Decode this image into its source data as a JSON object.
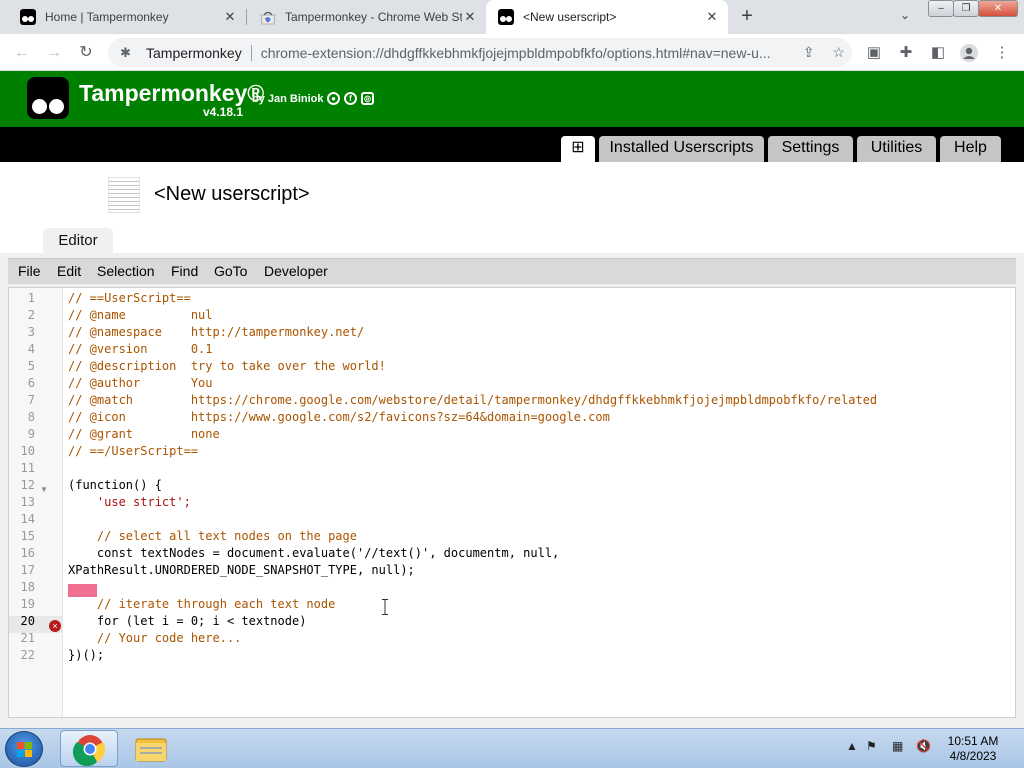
{
  "browser": {
    "tabs": [
      {
        "title": "Home | Tampermonkey",
        "icon": "tampermonkey-icon"
      },
      {
        "title": "Tampermonkey - Chrome Web Store",
        "icon": "chrome-web-store-icon"
      },
      {
        "title": "<New userscript>",
        "icon": "tampermonkey-icon"
      }
    ],
    "newtab_glyph": "+",
    "site_chip": "Tampermonkey",
    "url": "chrome-extension://dhdgffkkebhmkfjojejmpbldmpobfkfo/options.html#nav=new-u..."
  },
  "tm": {
    "brand": "Tampermonkey®",
    "by": "by Jan Biniok",
    "version": "v4.18.1",
    "nav": [
      "Installed Userscripts",
      "Settings",
      "Utilities",
      "Help"
    ],
    "add_glyph": "⊞"
  },
  "script": {
    "title": "<New userscript>",
    "editor_tab": "Editor"
  },
  "menu": [
    "File",
    "Edit",
    "Selection",
    "Find",
    "GoTo",
    "Developer"
  ],
  "code": {
    "lines": [
      "// ==UserScript==",
      "// @name         nul",
      "// @namespace    http://tampermonkey.net/",
      "// @version      0.1",
      "// @description  try to take over the world!",
      "// @author       You",
      "// @match        https://chrome.google.com/webstore/detail/tampermonkey/dhdgffkkebhmkfjojejmpbldmpobfkfo/related",
      "// @icon         https://www.google.com/s2/favicons?sz=64&domain=google.com",
      "// @grant        none",
      "// ==/UserScript==",
      "",
      "(function() {",
      "    'use strict';",
      "",
      "    // select all text nodes on the page",
      "    const textNodes = document.evaluate('//text()', documentm, null,",
      "XPathResult.UNORDERED_NODE_SNAPSHOT_TYPE, null);",
      "",
      "    // iterate through each text node",
      "    for (let i = 0; i < textnode)",
      "    // Your code here...",
      "})();"
    ],
    "current_line": 20,
    "error_glyph": "×"
  },
  "taskbar": {
    "time": "10:51 AM",
    "date": "4/8/2023"
  }
}
